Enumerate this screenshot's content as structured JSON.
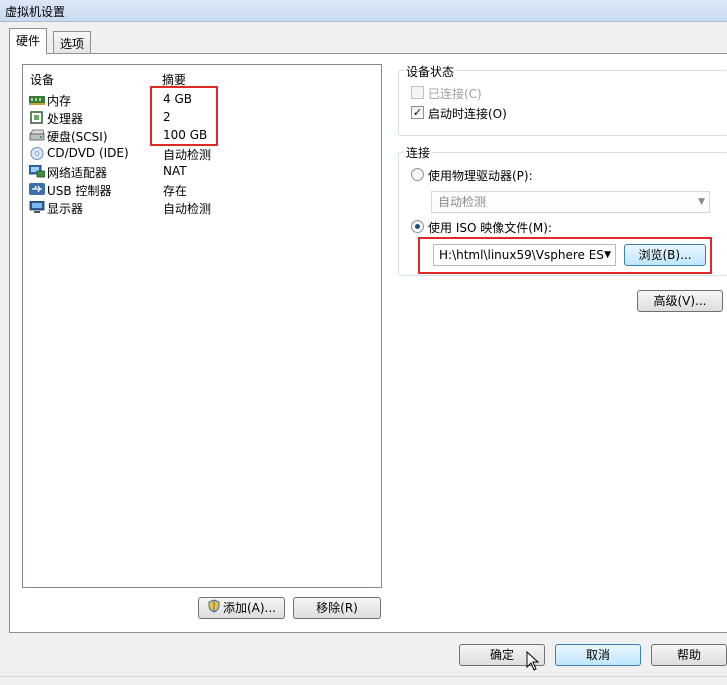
{
  "window": {
    "title": "虚拟机设置"
  },
  "tabs": [
    {
      "label": "硬件",
      "active": true
    },
    {
      "label": "选项",
      "active": false
    }
  ],
  "devices": {
    "header_device": "设备",
    "header_summary": "摘要",
    "items": [
      {
        "icon": "memory-icon",
        "name": "内存",
        "summary": "4 GB"
      },
      {
        "icon": "processor-icon",
        "name": "处理器",
        "summary": "2"
      },
      {
        "icon": "harddisk-icon",
        "name": "硬盘(SCSI)",
        "summary": "100 GB"
      },
      {
        "icon": "cd-dvd-icon",
        "name": "CD/DVD (IDE)",
        "summary": "自动检测"
      },
      {
        "icon": "network-adapter-icon",
        "name": "网络适配器",
        "summary": "NAT"
      },
      {
        "icon": "usb-icon",
        "name": "USB 控制器",
        "summary": "存在"
      },
      {
        "icon": "display-icon",
        "name": "显示器",
        "summary": "自动检测"
      }
    ],
    "add_button": "添加(A)...",
    "remove_button": "移除(R)"
  },
  "device_status": {
    "title": "设备状态",
    "connected": {
      "label": "已连接(C)",
      "checked": false,
      "enabled": false
    },
    "connect_at_power_on": {
      "label": "启动时连接(O)",
      "checked": true,
      "enabled": true
    }
  },
  "connection": {
    "title": "连接",
    "physical_drive": {
      "label": "使用物理驱动器(P):",
      "selected": false
    },
    "physical_drive_value": "自动检测",
    "iso_image": {
      "label": "使用 ISO 映像文件(M):",
      "selected": true
    },
    "iso_path": "H:\\html\\linux59\\Vsphere ES",
    "browse_button": "浏览(B)..."
  },
  "advanced_button": "高级(V)...",
  "footer": {
    "ok": "确定",
    "cancel": "取消",
    "help": "帮助"
  },
  "colors": {
    "highlight_box": "#e02a2a",
    "selection_accent": "#3c7fb1"
  }
}
